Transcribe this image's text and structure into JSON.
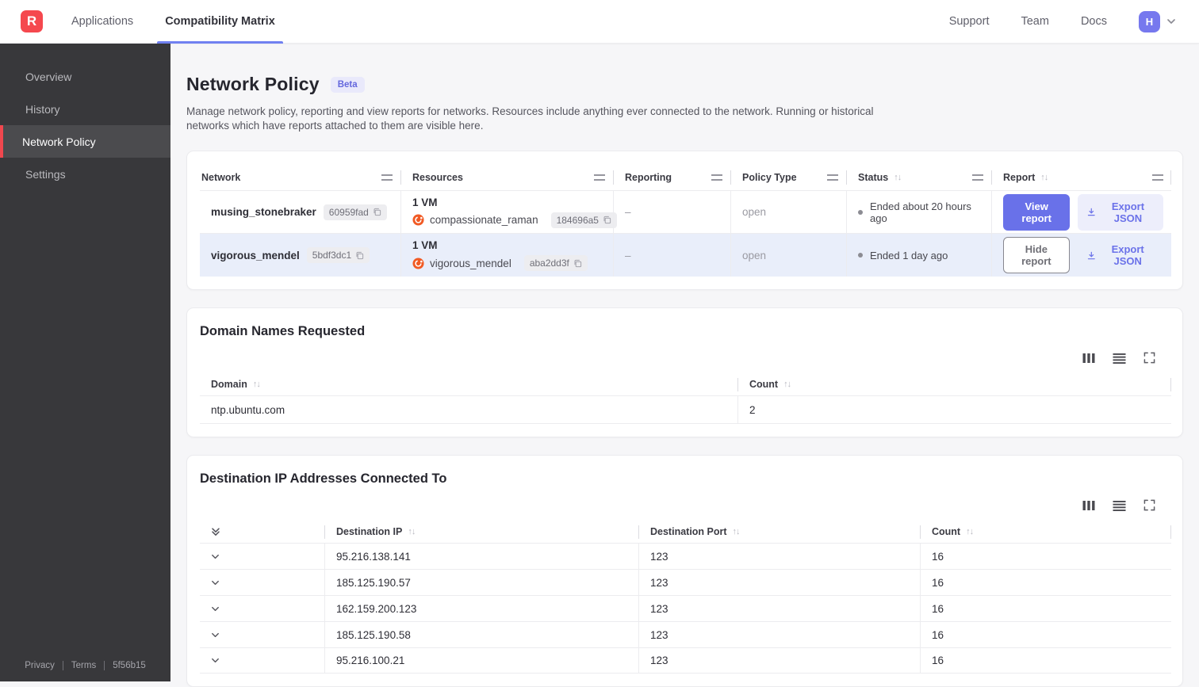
{
  "colors": {
    "brand_red": "#f5484e",
    "accent_purple": "#6971e9",
    "tab_underline": "#7080f0",
    "avatar_bg": "#7678ee",
    "sidebar_bg": "#38383b",
    "sidebar_active_bg": "#4b4b4e",
    "row_highlight": "#e9eefa",
    "beta_bg": "#e9e9fb"
  },
  "icons": [
    "copy-icon",
    "download-icon",
    "sort-icon",
    "column-drag-handle",
    "vm-logo-icon",
    "columns-icon",
    "density-icon",
    "fullscreen-icon",
    "chevron-down-icon",
    "double-chevron-icon",
    "status-dot"
  ],
  "topbar": {
    "logo": "R",
    "tabs": [
      {
        "label": "Applications"
      },
      {
        "label": "Compatibility Matrix"
      }
    ],
    "links": [
      {
        "label": "Support"
      },
      {
        "label": "Team"
      },
      {
        "label": "Docs"
      }
    ],
    "avatar": "H"
  },
  "sidebar": {
    "items": [
      {
        "label": "Overview"
      },
      {
        "label": "History"
      },
      {
        "label": "Network Policy"
      },
      {
        "label": "Settings"
      }
    ],
    "footer": {
      "privacy": "Privacy",
      "terms": "Terms",
      "version": "5f56b15"
    }
  },
  "page": {
    "title": "Network Policy",
    "badge": "Beta",
    "description": "Manage network policy, reporting and view reports for networks. Resources include anything ever connected to the network. Running or historical networks which have reports attached to them are visible here."
  },
  "networks_table": {
    "columns": {
      "network": "Network",
      "resources": "Resources",
      "reporting": "Reporting",
      "policy_type": "Policy Type",
      "status": "Status",
      "report": "Report"
    },
    "rows": [
      {
        "name": "musing_stonebraker",
        "id": "60959fad",
        "vm_count": "1 VM",
        "vm_name": "compassionate_raman",
        "vm_id": "184696a5",
        "reporting": "–",
        "policy_type": "open",
        "status": "Ended about 20 hours ago",
        "report_button": "View report",
        "export_button": "Export JSON"
      },
      {
        "name": "vigorous_mendel",
        "id": "5bdf3dc1",
        "vm_count": "1 VM",
        "vm_name": "vigorous_mendel",
        "vm_id": "aba2dd3f",
        "reporting": "–",
        "policy_type": "open",
        "status": "Ended 1 day ago",
        "report_button": "Hide report",
        "export_button": "Export JSON"
      }
    ]
  },
  "domains_card": {
    "title": "Domain Names Requested",
    "columns": {
      "domain": "Domain",
      "count": "Count"
    },
    "rows": [
      {
        "domain": "ntp.ubuntu.com",
        "count": "2"
      }
    ]
  },
  "destinations_card": {
    "title": "Destination IP Addresses Connected To",
    "columns": {
      "ip": "Destination IP",
      "port": "Destination Port",
      "count": "Count"
    },
    "rows": [
      {
        "ip": "95.216.138.141",
        "port": "123",
        "count": "16"
      },
      {
        "ip": "185.125.190.57",
        "port": "123",
        "count": "16"
      },
      {
        "ip": "162.159.200.123",
        "port": "123",
        "count": "16"
      },
      {
        "ip": "185.125.190.58",
        "port": "123",
        "count": "16"
      },
      {
        "ip": "95.216.100.21",
        "port": "123",
        "count": "16"
      }
    ]
  }
}
